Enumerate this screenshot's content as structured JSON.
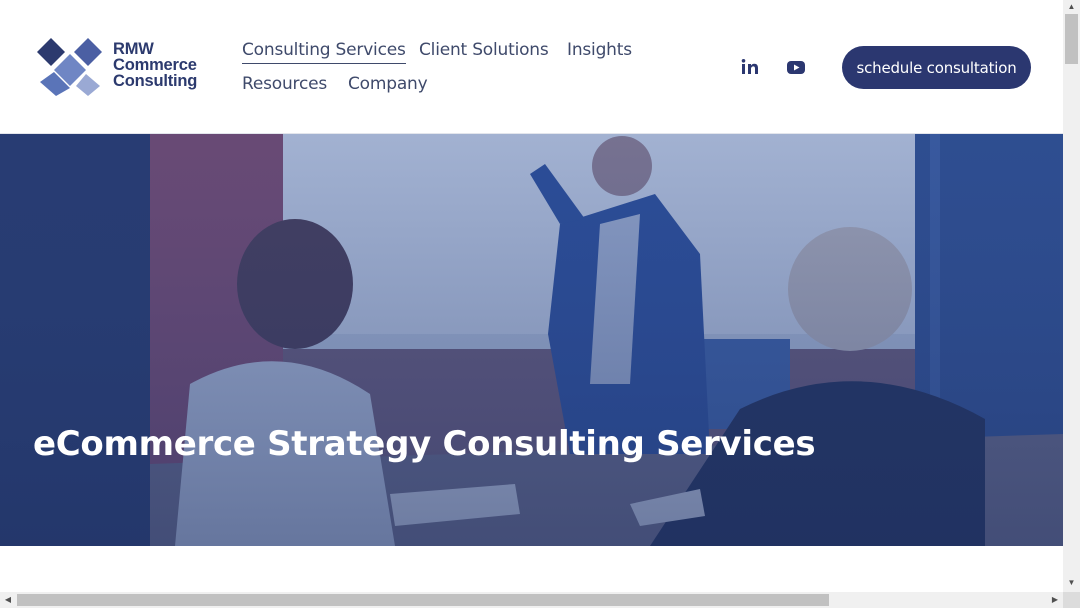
{
  "brand": {
    "line1": "RMW",
    "line2": "Commerce",
    "line3": "Consulting",
    "icon": "rmw-diamond-logo-icon"
  },
  "nav": {
    "consulting_services": "Consulting Services",
    "client_solutions": "Client Solutions",
    "insights": "Insights",
    "resources": "Resources",
    "company": "Company"
  },
  "social": {
    "linkedin_icon": "linkedin-icon",
    "youtube_icon": "youtube-icon"
  },
  "cta": {
    "label": "schedule consultation"
  },
  "hero": {
    "title": "eCommerce Strategy Consulting Services"
  },
  "colors": {
    "brand_navy": "#2b3770",
    "nav_text": "#3f4a6b",
    "hero_overlay": "#2d4a8a"
  }
}
